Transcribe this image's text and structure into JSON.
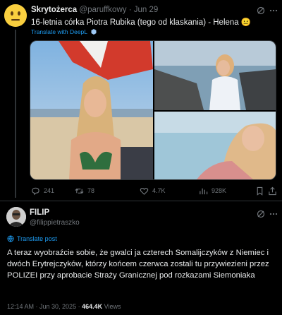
{
  "tweet1": {
    "author_name": "Skrytożerca",
    "handle": "@paruffkowy",
    "separator": "·",
    "time": "Jun 29",
    "text": "16-letnia córka Piotra Rubika (tego od klaskania) - Helena 😐",
    "translate_label": "Translate with DeepL",
    "actions": {
      "replies": "241",
      "retweets": "78",
      "likes": "4.7K",
      "views": "928K"
    }
  },
  "tweet2": {
    "author_name": "FILIP",
    "handle": "@filippietraszko",
    "translate_label": "Translate post",
    "text": "A teraz wyobraźcie sobie, że gwalci ja czterech Somalijczyków z Niemiec i dwóch Erytrejczyków, którzy końcem czerwca zostali tu przywiezieni przez POLIZEI przy aprobacie Straży Granicznej pod rozkazami Siemoniaka",
    "timestamp": "12:14 AM · Jun 30, 2025",
    "dot": "·",
    "views_count": "464.4K",
    "views_label": "Views"
  },
  "colors": {
    "background": "#000000",
    "text": "#e7e9ea",
    "muted": "#71767b",
    "link": "#1d9bf0",
    "divider": "#2f3336"
  }
}
